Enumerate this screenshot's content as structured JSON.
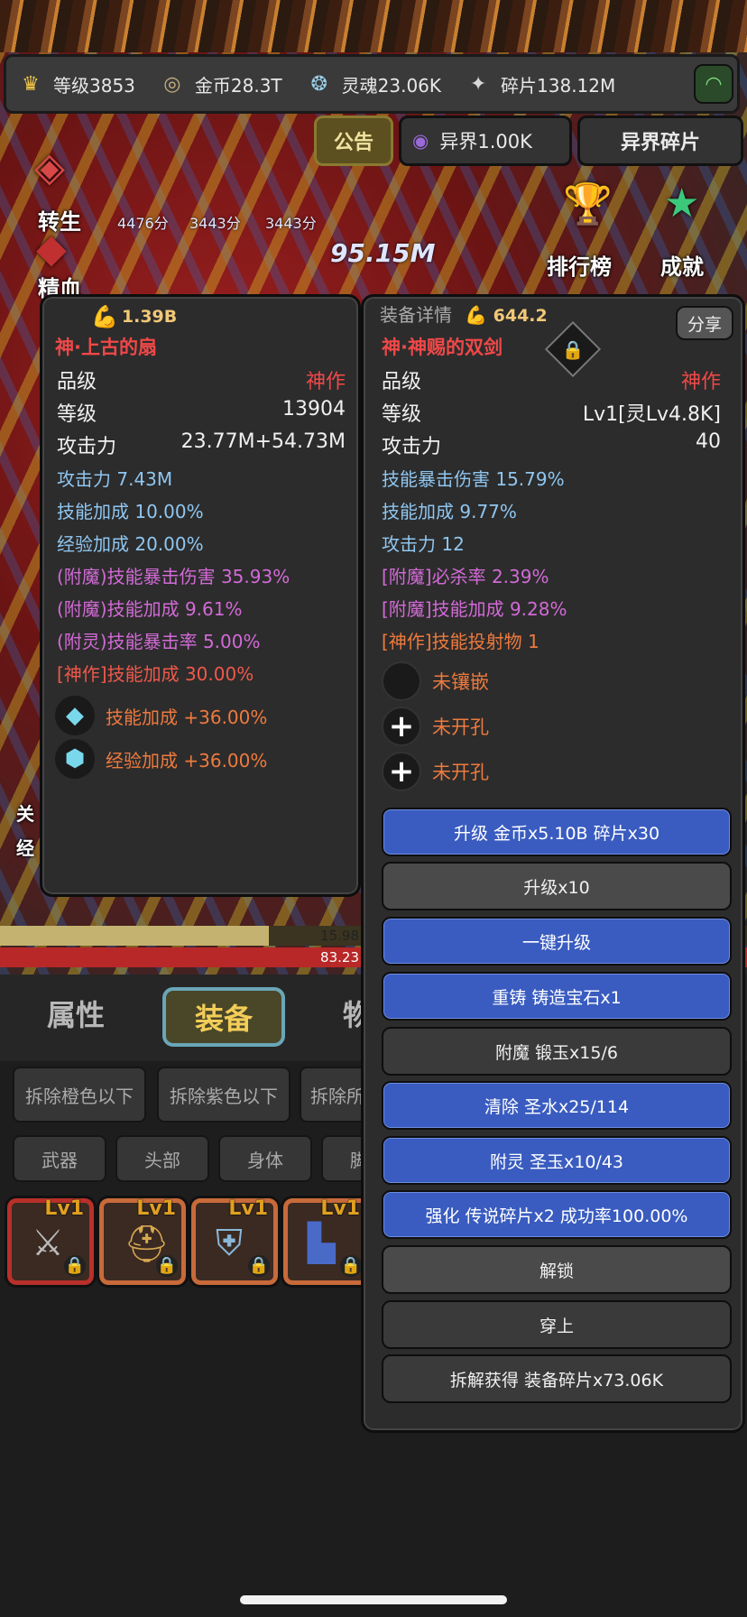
{
  "resources": [
    {
      "label": "等级3853",
      "icon": "crown-icon",
      "glyph": "♛",
      "color": "#f2c94c"
    },
    {
      "label": "金币28.3T",
      "icon": "gold-coin-icon",
      "glyph": "◎",
      "color": "#c8b080"
    },
    {
      "label": "灵魂23.06K",
      "icon": "soul-icon",
      "glyph": "❂",
      "color": "#9ad0ea"
    },
    {
      "label": "碎片138.12M",
      "icon": "shard-icon",
      "glyph": "✦",
      "color": "#d8d8d8"
    }
  ],
  "topbar": {
    "notice": "公告",
    "otherworld": "异界1.00K",
    "otherworld_shard": "异界碎片"
  },
  "battle": {
    "rebirth": "转生",
    "refine": "精血",
    "ranking": "排行榜",
    "achievement": "成就",
    "scores": [
      "4476分",
      "3443分",
      "3443分"
    ],
    "damage": "95.15M",
    "left_cut_1": "关",
    "left_cut_2": "经"
  },
  "bars": {
    "top_value": "15.98",
    "bottom_value": "83.23",
    "top_fill_fraction": 0.36
  },
  "tabs": {
    "attr": "属性",
    "equip": "装备",
    "item": "物"
  },
  "filters": [
    "拆除橙色以下",
    "拆除紫色以下",
    "拆除所"
  ],
  "slots": [
    "武器",
    "头部",
    "身体",
    "脚"
  ],
  "equip_slots": [
    {
      "level": "Lv1",
      "icon": "twin-swords-icon",
      "glyph": "⚔"
    },
    {
      "level": "Lv1",
      "icon": "helmet-icon",
      "glyph": "⛑"
    },
    {
      "level": "Lv1",
      "icon": "armor-icon",
      "glyph": "⛨"
    },
    {
      "level": "Lv1",
      "icon": "boots-icon",
      "glyph": "👢"
    }
  ],
  "current": {
    "power": "1.39B",
    "name": "神·上古的扇",
    "rows": [
      {
        "label": "品级",
        "value": "神作",
        "red": true
      },
      {
        "label": "等级",
        "value": "13904",
        "red": false
      },
      {
        "label": "攻击力",
        "value": "23.77M+54.73M",
        "red": false
      }
    ],
    "attrs": [
      {
        "text": "攻击力 7.43M",
        "color": "blue"
      },
      {
        "text": "技能加成 10.00%",
        "color": "blue"
      },
      {
        "text": "经验加成 20.00%",
        "color": "blue"
      },
      {
        "text": "(附魔)技能暴击伤害 35.93%",
        "color": "purple"
      },
      {
        "text": "(附魔)技能加成 9.61%",
        "color": "purple"
      },
      {
        "text": "(附灵)技能暴击率 5.00%",
        "color": "purple"
      },
      {
        "text": "[神作]技能加成 30.00%",
        "color": "red"
      }
    ],
    "gems": [
      {
        "text": "技能加成 +36.00%"
      },
      {
        "text": "经验加成 +36.00%"
      }
    ]
  },
  "detail": {
    "title": "装备详情",
    "power": "644.2",
    "share": "分享",
    "name": "神·神赐的双剑",
    "rows": [
      {
        "label": "品级",
        "value": "神作",
        "red": true
      },
      {
        "label": "等级",
        "value": "Lv1[灵Lv4.8K]",
        "red": false
      },
      {
        "label": "攻击力",
        "value": "40",
        "red": false
      }
    ],
    "attrs": [
      {
        "text": "技能暴击伤害 15.79%",
        "color": "blue"
      },
      {
        "text": "技能加成 9.77%",
        "color": "blue"
      },
      {
        "text": "攻击力 12",
        "color": "blue"
      },
      {
        "text": "[附魔]必杀率 2.39%",
        "color": "purple"
      },
      {
        "text": "[附魔]技能加成 9.28%",
        "color": "purple"
      },
      {
        "text": "[神作]技能投射物 1",
        "color": "orange"
      }
    ],
    "sockets": [
      {
        "text": "未镶嵌",
        "glyph": ""
      },
      {
        "text": "未开孔",
        "glyph": "+"
      },
      {
        "text": "未开孔",
        "glyph": "+"
      }
    ],
    "actions": [
      {
        "text": "升级 金币x5.10B 碎片x30",
        "style": "blue"
      },
      {
        "text": "升级x10",
        "style": "gray"
      },
      {
        "text": "一键升级",
        "style": "blue"
      },
      {
        "text": "重铸 铸造宝石x1",
        "style": "blue"
      },
      {
        "text": "附魔 锻玉x15/6",
        "style": "dark"
      },
      {
        "text": "清除 圣水x25/114",
        "style": "blue"
      },
      {
        "text": "附灵 圣玉x10/43",
        "style": "blue"
      },
      {
        "text": "强化 传说碎片x2 成功率100.00%",
        "style": "blue"
      },
      {
        "text": "解锁",
        "style": "gray"
      },
      {
        "text": "穿上",
        "style": "dark"
      },
      {
        "text": "拆解获得 装备碎片x73.06K",
        "style": "dark"
      }
    ]
  }
}
